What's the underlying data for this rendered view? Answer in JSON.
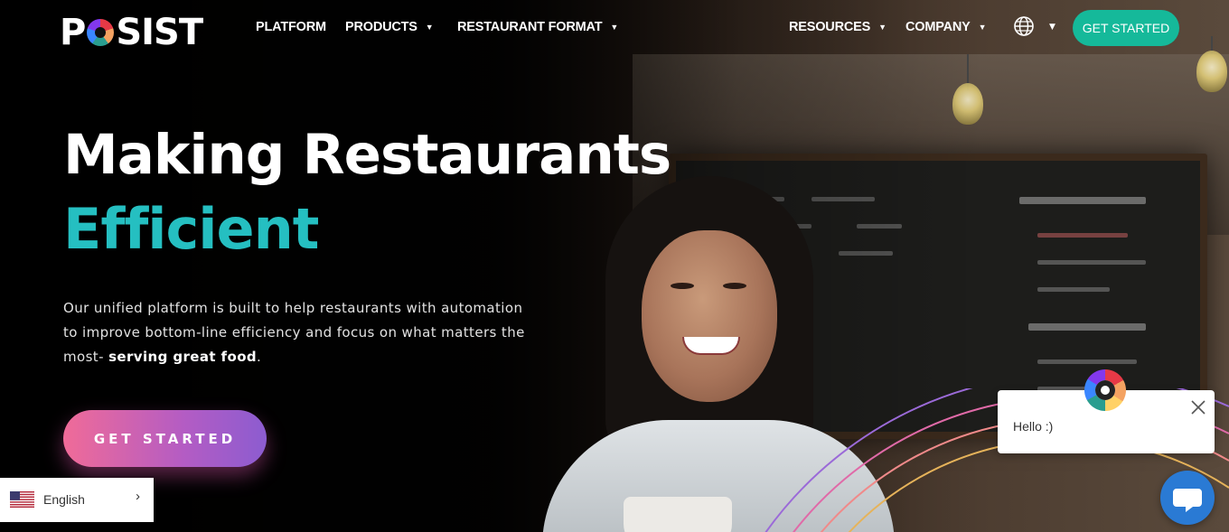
{
  "nav": {
    "logo_text": "POSIST",
    "items": [
      {
        "label": "PLATFORM",
        "has_dropdown": false
      },
      {
        "label": "PRODUCTS",
        "has_dropdown": true
      },
      {
        "label": "RESTAURANT FORMAT",
        "has_dropdown": true
      },
      {
        "label": "RESOURCES",
        "has_dropdown": true
      },
      {
        "label": "COMPANY",
        "has_dropdown": true
      }
    ],
    "language_icon": "globe-icon",
    "cta_label": "GET STARTED"
  },
  "hero": {
    "title_line1": "Making Restaurants",
    "title_line2": "Efficient",
    "lead_text": "Our unified platform is built to help restaurants with automation to improve bottom-line efficiency and focus on what matters the most- ",
    "lead_bold": "serving great food",
    "lead_end": ".",
    "cta_label": "GET STARTED"
  },
  "language_selector": {
    "label": "English",
    "flag_icon": "us-flag-icon"
  },
  "chat": {
    "greeting": "Hello :)",
    "avatar_icon": "posist-logo-icon",
    "close_icon": "close-icon",
    "launcher_icon": "chat-bubble-icon"
  },
  "colors": {
    "accent_teal": "#25bfc1",
    "cta_green": "#15b99a",
    "cta_gradient_start": "#f06b98",
    "cta_gradient_end": "#8c5cd0",
    "chat_blue": "#2a7ad4"
  }
}
